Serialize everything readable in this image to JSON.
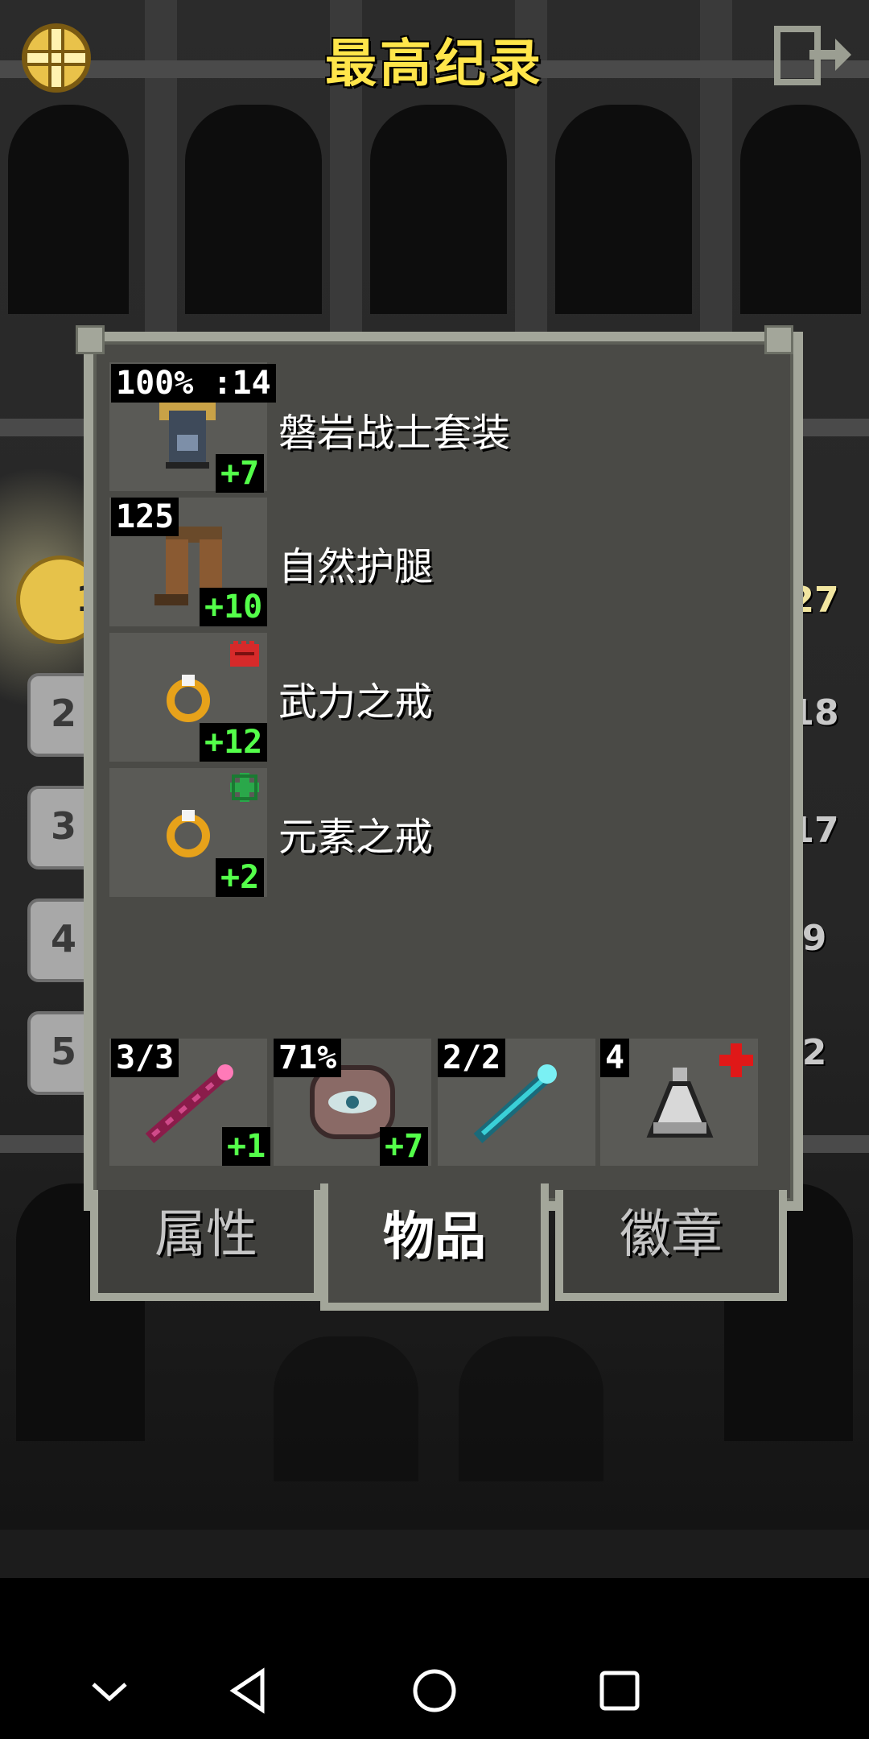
{
  "header": {
    "title": "最高纪录",
    "menu_icon": "golden-menu-gear-icon",
    "exit_icon": "exit-door-icon"
  },
  "rankings": {
    "left_ranks": [
      "1",
      "2",
      "3",
      "4",
      "5"
    ],
    "right_values": [
      "27",
      "18",
      "17",
      "9",
      "2"
    ]
  },
  "equipment": [
    {
      "name": "磐岩战士套装",
      "top_label": "100% :14",
      "upgrade": "+7",
      "icon": "armor-icon"
    },
    {
      "name": "自然护腿",
      "top_label": "125",
      "upgrade": "+10",
      "icon": "leg-armor-icon"
    },
    {
      "name": "武力之戒",
      "top_label": "",
      "upgrade": "+12",
      "icon": "ring-icon",
      "badge_icon": "red-fist-icon"
    },
    {
      "name": "元素之戒",
      "top_label": "",
      "upgrade": "+2",
      "icon": "ring-icon",
      "badge_icon": "green-element-icon"
    }
  ],
  "quickslots": [
    {
      "top_label": "3/3",
      "upgrade": "+1",
      "icon": "magic-wand-icon"
    },
    {
      "top_label": "71%",
      "upgrade": "+7",
      "icon": "artifact-eye-icon"
    },
    {
      "top_label": "2/2",
      "upgrade": "",
      "icon": "cyan-wand-icon"
    },
    {
      "top_label": "4",
      "upgrade": "",
      "icon": "potion-flask-icon",
      "badge_icon": "red-cross-icon"
    }
  ],
  "tabs": {
    "stats": "属性",
    "items": "物品",
    "badges": "徽章",
    "active": "items"
  },
  "colors": {
    "title": "#ffe54a",
    "upgrade_green": "#54ff4a",
    "panel_border": "#a3a69a",
    "panel_bg": "#4a4a46"
  }
}
